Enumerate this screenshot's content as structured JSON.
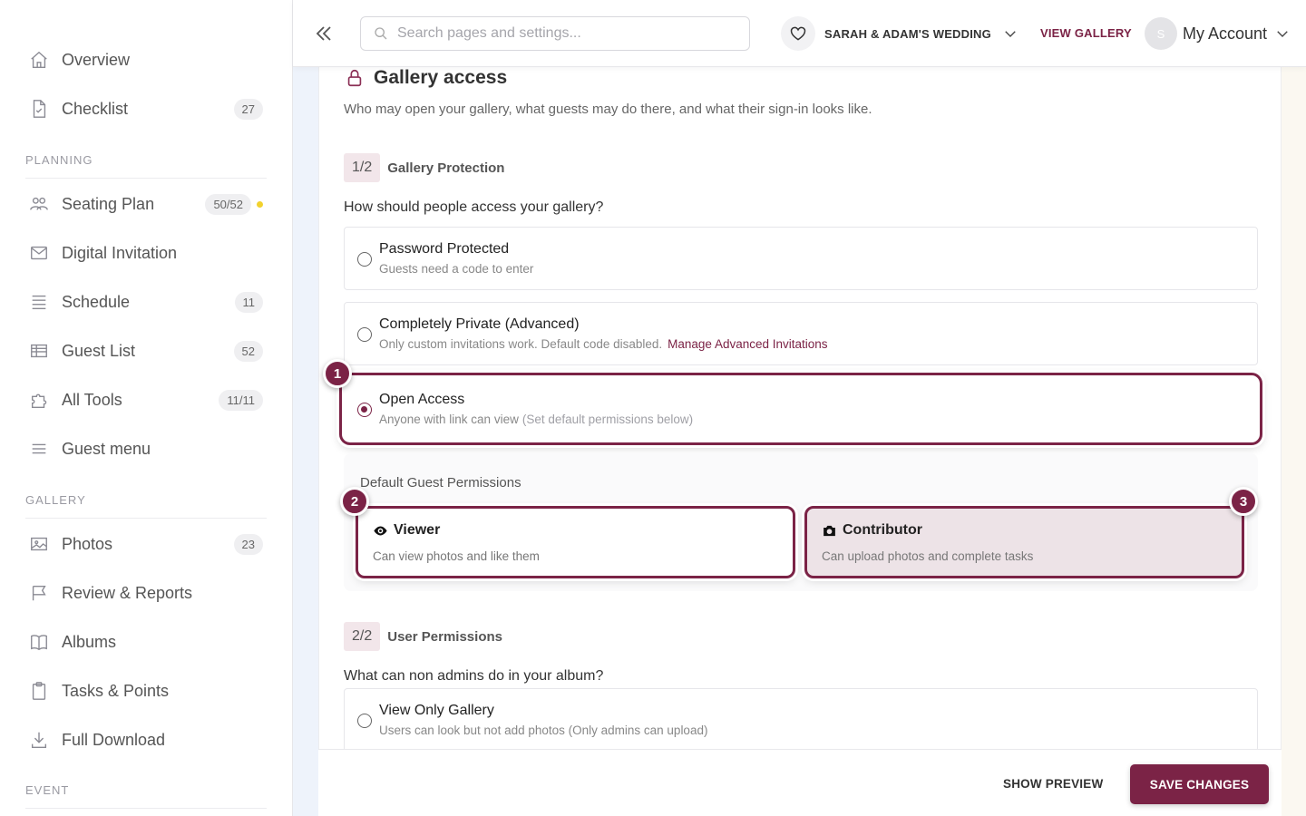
{
  "colors": {
    "accent": "#7b2346",
    "badge_bg": "#f2e6ea",
    "dot": "#f2d22e"
  },
  "sidebar": {
    "top_items": [
      {
        "label": "Overview",
        "icon": "home-icon",
        "count": ""
      },
      {
        "label": "Checklist",
        "icon": "checklist-icon",
        "count": "27"
      }
    ],
    "sections": [
      {
        "title": "PLANNING"
      },
      {
        "title": "GALLERY"
      },
      {
        "title": "EVENT"
      }
    ],
    "planning_items": [
      {
        "label": "Seating Plan",
        "icon": "people-icon",
        "count": "50/52"
      },
      {
        "label": "Digital Invitation",
        "icon": "mail-icon",
        "count": ""
      },
      {
        "label": "Schedule",
        "icon": "list-icon",
        "count": "11"
      },
      {
        "label": "Guest List",
        "icon": "table-icon",
        "count": "52"
      },
      {
        "label": "All Tools",
        "icon": "puzzle-icon",
        "count": "11/11"
      },
      {
        "label": "Guest menu",
        "icon": "menu-icon",
        "count": ""
      }
    ],
    "gallery_items": [
      {
        "label": "Photos",
        "icon": "image-icon",
        "count": "23"
      },
      {
        "label": "Review & Reports",
        "icon": "flag-icon",
        "count": ""
      },
      {
        "label": "Albums",
        "icon": "book-icon",
        "count": ""
      },
      {
        "label": "Tasks & Points",
        "icon": "clipboard-icon",
        "count": ""
      },
      {
        "label": "Full Download",
        "icon": "download-icon",
        "count": ""
      }
    ]
  },
  "header": {
    "search_placeholder": "Search pages and settings...",
    "event_name": "SARAH & ADAM'S WEDDING",
    "view_gallery": "VIEW GALLERY",
    "avatar_initial": "S",
    "account_label": "My Account"
  },
  "main": {
    "title": "Gallery access",
    "subtitle": "Who may open your gallery, what guests may do there, and what their sign-in looks like.",
    "step1": {
      "badge": "1/2",
      "title": "Gallery Protection"
    },
    "question1": "How should people access your gallery?",
    "options": [
      {
        "title": "Password Protected",
        "desc": "Guests need a code to enter",
        "selected": false
      },
      {
        "title": "Completely Private (Advanced)",
        "desc": "Only custom invitations work. Default code disabled.",
        "link": "Manage Advanced Invitations",
        "selected": false
      },
      {
        "title": "Open Access",
        "desc": "Anyone with link can view",
        "hint": "(Set default permissions below)",
        "selected": true
      }
    ],
    "permissions": {
      "label": "Default Guest Permissions",
      "viewer": {
        "title": "Viewer",
        "desc": "Can view photos and like them",
        "icon": "eye-icon"
      },
      "contributor": {
        "title": "Contributor",
        "desc": "Can upload photos and complete tasks",
        "icon": "camera-icon",
        "selected": true
      }
    },
    "step2": {
      "badge": "2/2",
      "title": "User Permissions"
    },
    "question2": "What can non admins do in your album?",
    "user_options": [
      {
        "title": "View Only Gallery",
        "desc": "Users can look but not add photos (Only admins can upload)"
      }
    ],
    "markers": [
      "1",
      "2",
      "3"
    ]
  },
  "footer": {
    "show_preview": "SHOW PREVIEW",
    "save": "SAVE CHANGES"
  }
}
